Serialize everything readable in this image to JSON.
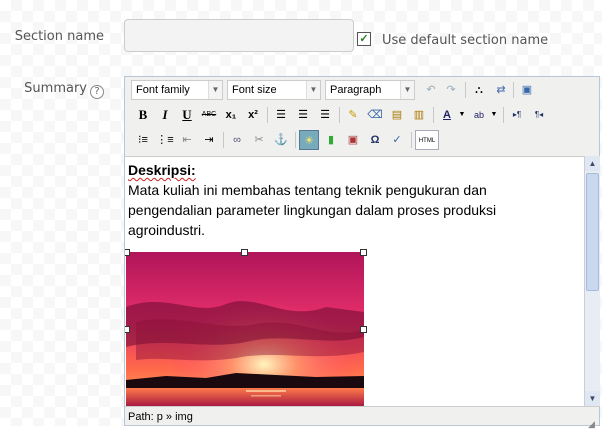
{
  "form": {
    "section_name_label": "Section name",
    "section_name_value": "",
    "use_default_label": "Use default section name",
    "use_default_checked": "✓",
    "summary_label": "Summary",
    "help_icon": "?"
  },
  "editor": {
    "font_family": "Font family",
    "font_size": "Font size",
    "paragraph": "Paragraph",
    "toolbar_row1": [
      "undo",
      "redo",
      "find",
      "replace",
      "fullscreen"
    ],
    "toolbar_row2": {
      "bold": "B",
      "italic": "I",
      "underline": "U",
      "strike": "ABC",
      "subscript": "x₁",
      "superscript": "x²"
    },
    "html_button": "HTML",
    "content": {
      "heading": "Deskripsi:",
      "line1": "Mata kuliah ini membahas tentang teknik pengukuran dan",
      "line2": "pengendalian parameter lingkungan dalam proses produksi",
      "line3": "agroindustri."
    },
    "path": "Path: p » img",
    "icons": {
      "undo": "undo-icon",
      "redo": "redo-icon",
      "find": "find-icon",
      "replace": "replace-icon",
      "fullscreen": "fullscreen-icon",
      "image": "sunset-image"
    }
  }
}
